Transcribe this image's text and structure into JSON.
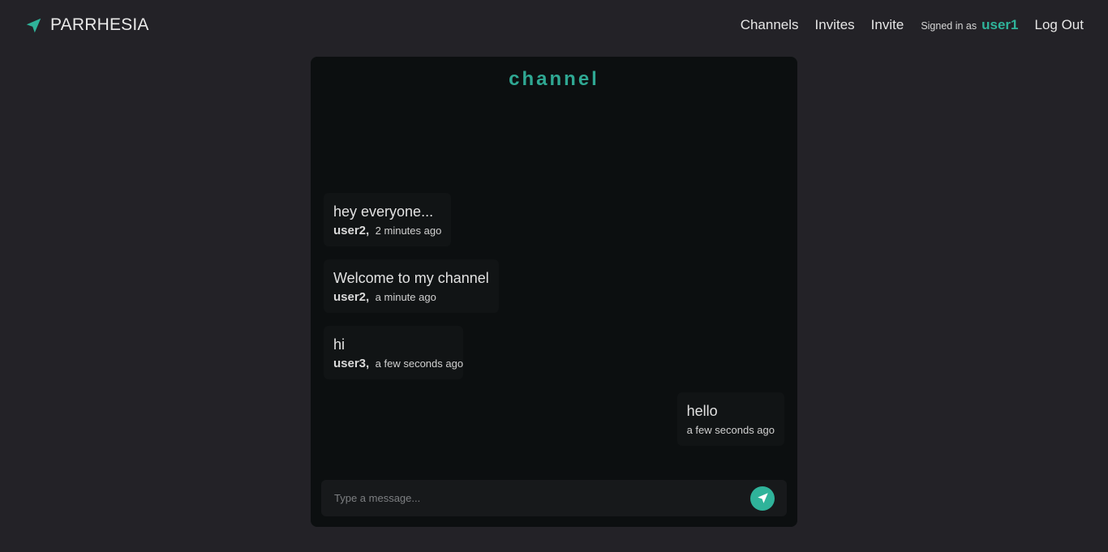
{
  "navbar": {
    "brand": "PARRHESIA",
    "links": {
      "channels": "Channels",
      "invites": "Invites",
      "invite": "Invite"
    },
    "signed_in_label": "Signed in as",
    "username": "user1",
    "logout": "Log Out"
  },
  "channel": {
    "title": "channel",
    "messages": [
      {
        "text": "hey everyone...",
        "author": "user2,",
        "time": "2 minutes ago"
      },
      {
        "text": "Welcome to my channel",
        "author": "user2,",
        "time": "a minute ago"
      },
      {
        "text": "hi",
        "author": "user3,",
        "time": "a few seconds ago"
      },
      {
        "text": "hello",
        "time": "a few seconds ago"
      }
    ]
  },
  "composer": {
    "placeholder": "Type a message..."
  },
  "icons": {
    "brand": "paper-plane-icon",
    "send": "send-icon"
  },
  "colors": {
    "accent": "#2fb39a",
    "background": "#232227",
    "panel": "#0c0f10"
  }
}
